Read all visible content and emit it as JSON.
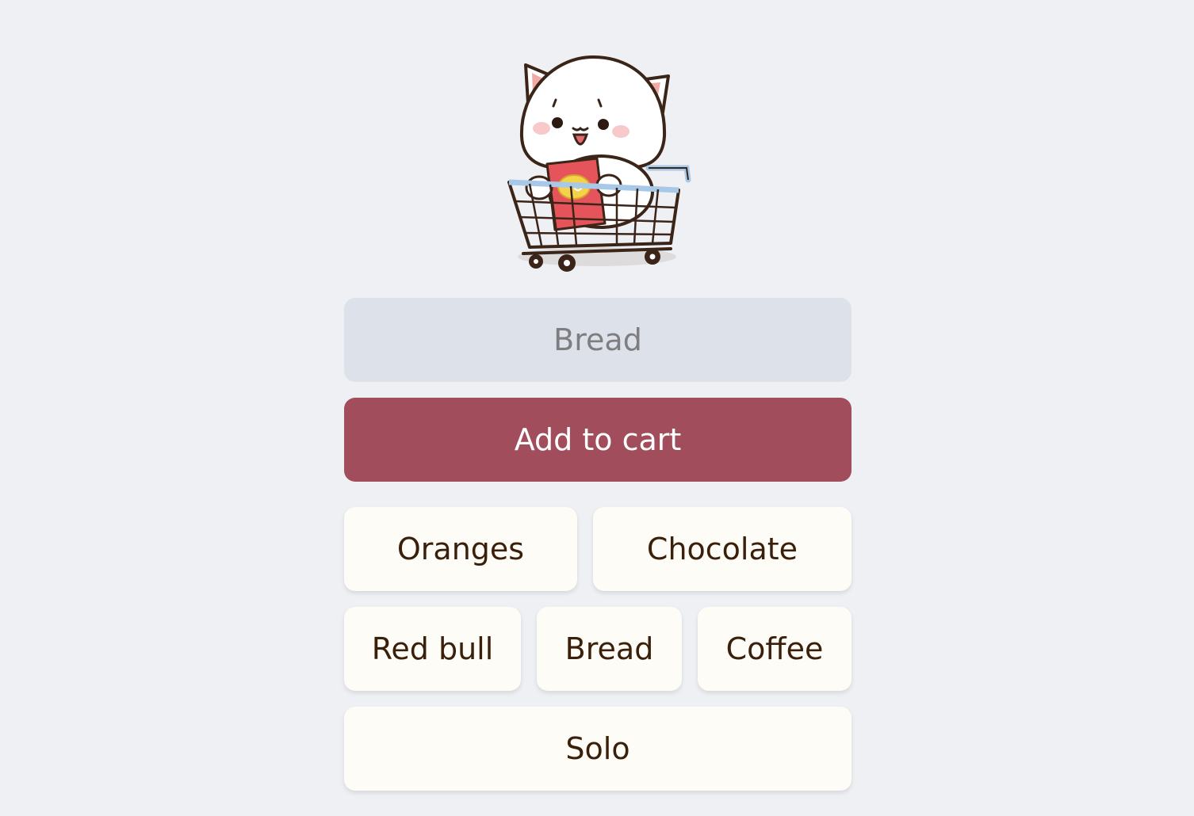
{
  "input": {
    "placeholder": "Bread"
  },
  "add_button": {
    "label": "Add to cart",
    "color": "#a24d5c"
  },
  "suggestions": [
    {
      "label": "Oranges"
    },
    {
      "label": "Chocolate"
    },
    {
      "label": "Red bull"
    },
    {
      "label": "Bread"
    },
    {
      "label": "Coffee"
    },
    {
      "label": "Solo"
    }
  ],
  "mascot": {
    "icon": "cat-in-shopping-cart-icon"
  },
  "colors": {
    "background": "#eef0f4",
    "input_bg": "#dde1e9",
    "chip_bg": "#fdfcf7",
    "chip_text": "#3a1f0b"
  }
}
